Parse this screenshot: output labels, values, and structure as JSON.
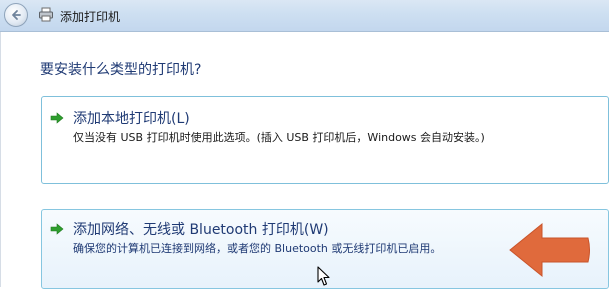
{
  "window": {
    "title": "添加打印机",
    "back_icon": "back-arrow-icon",
    "title_icon": "printer-icon"
  },
  "main": {
    "question": "要安装什么类型的打印机?",
    "options": [
      {
        "title": "添加本地打印机(L)",
        "description": "仅当没有 USB 打印机时使用此选项。(插入 USB 打印机后，Windows 会自动安装。)",
        "icon": "green-arrow-icon"
      },
      {
        "title": "添加网络、无线或 Bluetooth 打印机(W)",
        "description": "确保您的计算机已连接到网络，或者您的 Bluetooth 或无线打印机已启用。",
        "icon": "green-arrow-icon",
        "state": "hover"
      }
    ]
  },
  "overlay": {
    "annotation_icon": "orange-pointer-arrow-icon",
    "cursor_icon": "mouse-cursor-icon"
  },
  "colors": {
    "heading": "#1f3a74",
    "option_border": "#7fc0db",
    "annotation": "#e06a3c",
    "arrow_green": "#2e9e2e"
  }
}
